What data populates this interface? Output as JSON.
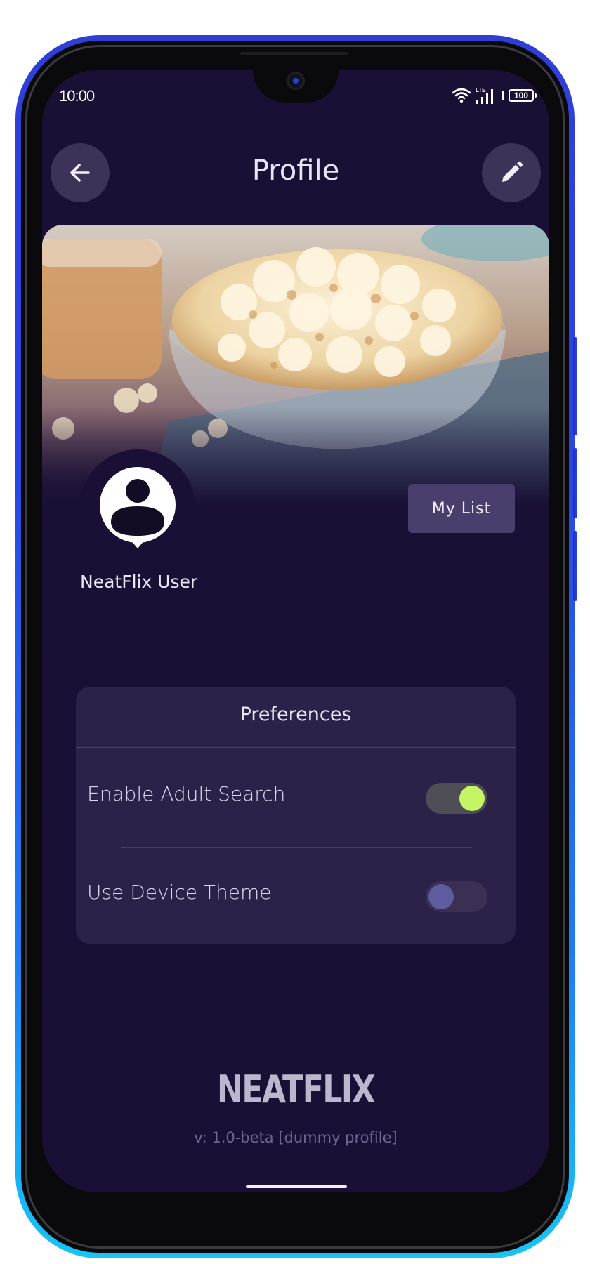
{
  "status_bar": {
    "time": "10:00",
    "network": "LTE",
    "battery": "100"
  },
  "header": {
    "title": "Profile",
    "back_icon": "arrow-left-icon",
    "edit_icon": "pencil-icon"
  },
  "profile": {
    "banner_image": "popcorn-bowl-photo",
    "user_name": "NeatFlix User",
    "my_list_label": "My List"
  },
  "preferences": {
    "title": "Preferences",
    "items": [
      {
        "label": "Enable Adult Search",
        "enabled": true
      },
      {
        "label": "Use Device Theme",
        "enabled": false
      }
    ]
  },
  "footer": {
    "brand": "NEATFLIX",
    "version": "v: 1.0-beta [dummy profile]"
  },
  "colors": {
    "background": "#1a1035",
    "card": "#2c2249",
    "accent_toggle_on": "#c5f464",
    "button": "#4a3f6c"
  }
}
